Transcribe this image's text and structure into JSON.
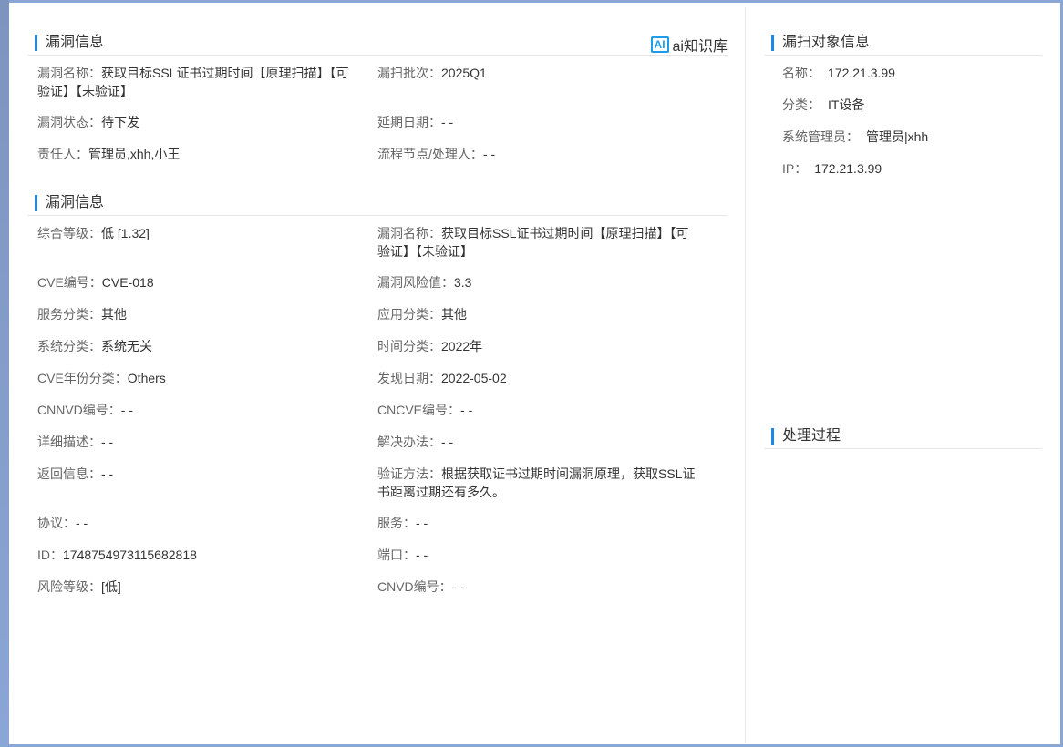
{
  "main": {
    "section1": {
      "title": "漏洞信息",
      "ai_label": "ai知识库",
      "ai_badge": "AI",
      "fields": [
        {
          "label": "漏洞名称：",
          "value": "获取目标SSL证书过期时间【原理扫描】【可验证】【未验证】"
        },
        {
          "label": "漏扫批次：",
          "value": "2025Q1"
        },
        {
          "label": "漏洞状态：",
          "value": "待下发"
        },
        {
          "label": "延期日期：",
          "value": "- -"
        },
        {
          "label": "责任人：",
          "value": "管理员,xhh,小王"
        },
        {
          "label": "流程节点/处理人：",
          "value": "- -"
        }
      ]
    },
    "section2": {
      "title": "漏洞信息",
      "fields": [
        {
          "label": "综合等级：",
          "value": "低 [1.32]"
        },
        {
          "label": "漏洞名称：",
          "value": "获取目标SSL证书过期时间【原理扫描】【可验证】【未验证】"
        },
        {
          "label": "CVE编号：",
          "value": "CVE-018"
        },
        {
          "label": "漏洞风险值：",
          "value": "3.3"
        },
        {
          "label": "服务分类：",
          "value": "其他"
        },
        {
          "label": "应用分类：",
          "value": "其他"
        },
        {
          "label": "系统分类：",
          "value": "系统无关"
        },
        {
          "label": "时间分类：",
          "value": "2022年"
        },
        {
          "label": "CVE年份分类：",
          "value": "Others"
        },
        {
          "label": "发现日期：",
          "value": "2022-05-02"
        },
        {
          "label": "CNNVD编号：",
          "value": "- -"
        },
        {
          "label": "CNCVE编号：",
          "value": "- -"
        },
        {
          "label": "详细描述：",
          "value": "- -"
        },
        {
          "label": "解决办法：",
          "value": "- -"
        },
        {
          "label": "返回信息：",
          "value": "- -"
        },
        {
          "label": "验证方法：",
          "value": "根据获取证书过期时间漏洞原理，获取SSL证书距离过期还有多久。"
        },
        {
          "label": "协议：",
          "value": "- -"
        },
        {
          "label": "服务：",
          "value": "- -"
        },
        {
          "label": "ID：",
          "value": "1748754973115682818"
        },
        {
          "label": "端口：",
          "value": "- -"
        },
        {
          "label": "风险等级：",
          "value": "[低]"
        },
        {
          "label": "CNVD编号：",
          "value": "- -"
        }
      ]
    }
  },
  "side": {
    "object_section": {
      "title": "漏扫对象信息",
      "fields": [
        {
          "label": "名称：",
          "value": "172.21.3.99"
        },
        {
          "label": "分类：",
          "value": "IT设备"
        },
        {
          "label": "系统管理员：",
          "value": "管理员|xhh"
        },
        {
          "label": "IP：",
          "value": "172.21.3.99"
        }
      ]
    },
    "process_section": {
      "title": "处理过程"
    }
  },
  "colors": {
    "accent": "#1e88e5",
    "frame": "#8aa6d6",
    "divider": "#e4e7ed"
  }
}
